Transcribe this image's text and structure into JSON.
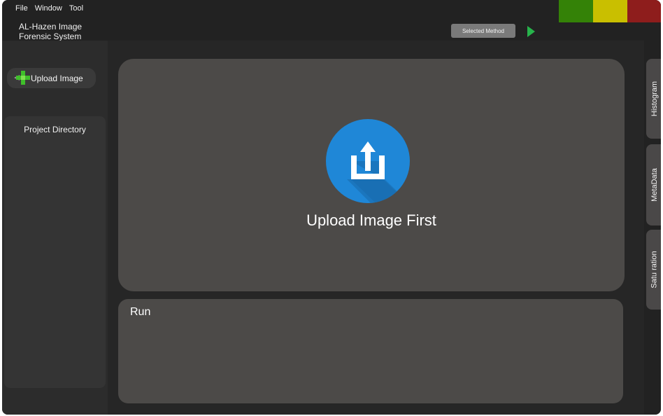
{
  "menu": {
    "items": [
      "File",
      "Window",
      "Tool"
    ]
  },
  "app": {
    "title_line1": "AL-Hazen Image",
    "title_line2": "Forensic System"
  },
  "toolbar": {
    "selected_method_label": "Selected Method",
    "status_colors": [
      "#348207",
      "#c9bf00",
      "#8e1d1c"
    ]
  },
  "sidebar": {
    "upload_label": "Upload Image",
    "project_directory_label": "Project Directory"
  },
  "viewer": {
    "placeholder_text": "Upload Image First",
    "icon": "upload-icon"
  },
  "run_panel": {
    "label": "Run"
  },
  "right_tabs": [
    "Histogram",
    "MetaData",
    "Satu ration"
  ]
}
